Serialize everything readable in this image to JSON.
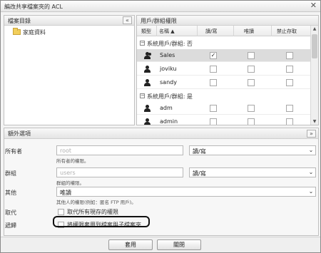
{
  "dialog": {
    "title": "編改共享檔案夾的 ACL",
    "close_glyph": "✕"
  },
  "folder_pane": {
    "header": "檔案目錄",
    "collapse_glyph": "«",
    "tree": [
      {
        "label": "家庭資料"
      }
    ]
  },
  "acl_pane": {
    "header": "用戶/群組權限",
    "columns": {
      "type": "類型",
      "name": "名稱 ▲",
      "read_write": "讀/寫",
      "read_only": "唯讀",
      "deny": "禁止存取"
    },
    "groups": [
      {
        "label": "系統用戶/群組: 否"
      },
      {
        "label": "系統用戶/群組: 是"
      }
    ],
    "rows": [
      {
        "name": "Sales",
        "kind": "group",
        "read_write": true,
        "read_only": false,
        "deny": false,
        "selected": true
      },
      {
        "name": "joviku",
        "kind": "user",
        "read_write": false,
        "read_only": false,
        "deny": false,
        "selected": false
      },
      {
        "name": "sandy",
        "kind": "user",
        "read_write": false,
        "read_only": false,
        "deny": false,
        "selected": false
      },
      {
        "name": "adm",
        "kind": "user",
        "read_write": false,
        "read_only": false,
        "deny": false,
        "selected": false
      },
      {
        "name": "admin",
        "kind": "user",
        "read_write": false,
        "read_only": false,
        "deny": false,
        "selected": false
      }
    ],
    "scroll": {
      "up": "▲",
      "down": "▼"
    }
  },
  "options": {
    "header": "額外選項",
    "expand_glyph": "»",
    "owner": {
      "label": "所有者",
      "value": "root",
      "permission": "讀/寫",
      "hint": "所有者的權限。"
    },
    "group": {
      "label": "群組",
      "value": "users",
      "permission": "讀/寫",
      "hint": "群組的權限。"
    },
    "others": {
      "label": "其他",
      "value": "唯讀",
      "hint": "其他人的權限(例如：匿名 FTP 用戶)。"
    },
    "replace": {
      "label": "取代",
      "checkbox_label": "取代所有現存的權限"
    },
    "recursive": {
      "label": "遞歸",
      "checkbox_label": "將權限套用到檔案與子檔案夾"
    },
    "dropdown_glyph": "⌄"
  },
  "footer": {
    "apply": "套用",
    "close": "關閉"
  }
}
